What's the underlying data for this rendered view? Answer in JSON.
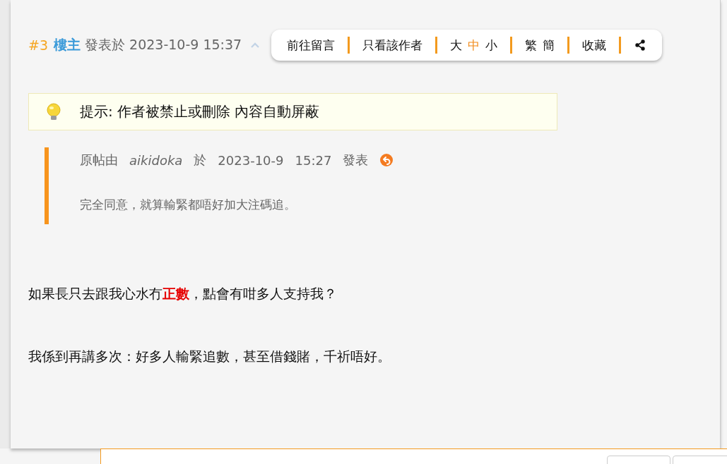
{
  "post": {
    "floor": "#3",
    "role": "樓主",
    "posted": "發表於 2023-10-9 15:37"
  },
  "toolbar": {
    "goto": "前往留言",
    "only_author": "只看該作者",
    "font_sizes": [
      {
        "label": "大",
        "selected": false
      },
      {
        "label": "中",
        "selected": true
      },
      {
        "label": "小",
        "selected": false
      }
    ],
    "scripts": [
      "繁",
      "簡"
    ],
    "favorite": "收藏"
  },
  "notice": "提示: 作者被禁止或刪除 內容自動屏蔽",
  "quote": {
    "prefix": "原帖由",
    "author": "aikidoka",
    "at": "於",
    "date": "2023-10-9",
    "time": "15:27",
    "suffix": "發表",
    "text": "完全同意，就算輸緊都唔好加大注碼追。"
  },
  "body": [
    "如果長只去跟我心水冇**正數**，點會有咁多人支持我？",
    "我係到再講多次：好多人輸緊追數，甚至借錢賭，千祈唔好。"
  ]
}
